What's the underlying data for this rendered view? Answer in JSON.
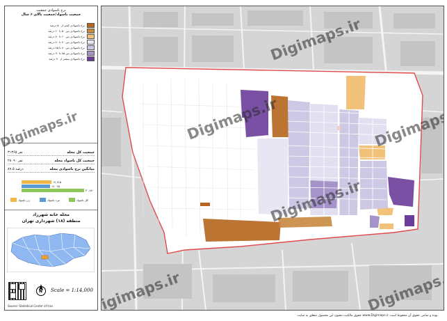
{
  "legend": {
    "title_line1": "نرخ باسوادی جمعیت",
    "title_line2": "جمعیت باسواد/جمعیت بالای ۶ سال",
    "classes": [
      {
        "label": "نرخ باسوادی کمتر از ۵۰ درصد",
        "color": "#b5651d"
      },
      {
        "label": "نرخ باسوادی بین ۵۰ تا ۶۰ درصد",
        "color": "#c98a3f"
      },
      {
        "label": "نرخ باسوادی بین ۶۰ تا ۷۰ درصد",
        "color": "#f3c27a"
      },
      {
        "label": "نرخ باسوادی بین ۷۰ تا ۸۰ درصد",
        "color": "#e8e6f2"
      },
      {
        "label": "نرخ باسوادی بین ۸۰ تا ۸۵ درصد",
        "color": "#cdc8e3"
      },
      {
        "label": "نرخ باسوادی بین ۸۵ تا ۹۰ درصد",
        "color": "#a594c9"
      },
      {
        "label": "نرخ باسوادی بیشتر از ۹۰ درصد",
        "color": "#6a3d9a"
      }
    ]
  },
  "stats": [
    {
      "label": "جمعیت کل محله",
      "value": "۳۱۳۶۵ نفر"
    },
    {
      "label": "جمعیت کل باسواد محله",
      "value": "۲۸۰۹۰ نفر"
    },
    {
      "label": "میانگین نرخ باسوادی محله",
      "value": "۸۹.۵ درصد"
    }
  ],
  "bars": [
    {
      "value_label": "۱۴,۹۱۵",
      "value": 14915,
      "color": "#f0b84a"
    },
    {
      "value_label": "۱۴,۰۴۵",
      "value": 14045,
      "color": "#5b9bd5"
    },
    {
      "value_label": "۳۰,۸۷۰",
      "value": 30870,
      "color": "#8fc65a"
    }
  ],
  "bar_legend": [
    {
      "label": "زن باسواد",
      "color": "#f0b84a"
    },
    {
      "label": "مرد باسواد",
      "color": "#5b9bd5"
    },
    {
      "label": "کل باسواد",
      "color": "#8fc65a"
    }
  ],
  "location": {
    "title": "محله خانه شهرزاد",
    "subtitle": "منطقه (۱۸) شهرداری تهران"
  },
  "scale": "Scale = 1:14,000",
  "north_label": "N",
  "credit": "Source: Statistical Center of Iran",
  "footer_text": "حقوق مالکیت معنوی این محصول متعلق به سایت www.Digimaps.ir بوده و تمامی حقوق آن محفوظ است.",
  "watermark": "Digimaps.ir",
  "colors": {
    "boundary": "#e04a4a",
    "land": "#d9d9d9",
    "road": "#f6f6f6",
    "area_fill": "#ffffff"
  }
}
